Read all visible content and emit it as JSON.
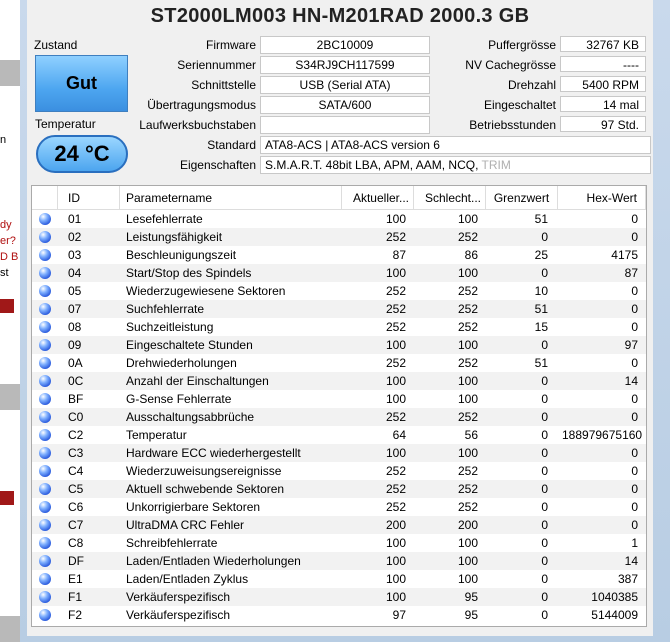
{
  "title": "ST2000LM003 HN-M201RAD  2000.3 GB",
  "status": {
    "health_label": "Zustand",
    "health_value": "Gut",
    "temp_label": "Temperatur",
    "temp_value": "24 °C"
  },
  "info": {
    "firmware_label": "Firmware",
    "firmware": "2BC10009",
    "serial_label": "Seriennummer",
    "serial": "S34RJ9CH117599",
    "interface_label": "Schnittstelle",
    "interface": "USB (Serial ATA)",
    "transfer_label": "Übertragungsmodus",
    "transfer": "SATA/600",
    "drive_letter_label": "Laufwerksbuchstaben",
    "drive_letter": "",
    "standard_label": "Standard",
    "standard": "ATA8-ACS | ATA8-ACS version 6",
    "features_label": "Eigenschaften",
    "features": "S.M.A.R.T.  48bit LBA,  APM,  AAM,  NCQ,",
    "features_disabled": "TRIM",
    "buffer_label": "Puffergrösse",
    "buffer": "32767 KB",
    "nvcache_label": "NV Cachegrösse",
    "nvcache": "----",
    "rpm_label": "Drehzahl",
    "rpm": "5400 RPM",
    "powercount_label": "Eingeschaltet",
    "powercount": "14 mal",
    "hours_label": "Betriebsstunden",
    "hours": "97 Std."
  },
  "table": {
    "headers": [
      "ID",
      "Parametername",
      "Aktueller...",
      "Schlecht...",
      "Grenzwert",
      "Hex-Wert"
    ],
    "rows": [
      [
        "01",
        "Lesefehlerrate",
        "100",
        "100",
        "51",
        "0"
      ],
      [
        "02",
        "Leistungsfähigkeit",
        "252",
        "252",
        "0",
        "0"
      ],
      [
        "03",
        "Beschleunigungszeit",
        "87",
        "86",
        "25",
        "4175"
      ],
      [
        "04",
        "Start/Stop des Spindels",
        "100",
        "100",
        "0",
        "87"
      ],
      [
        "05",
        "Wiederzugewiesene Sektoren",
        "252",
        "252",
        "10",
        "0"
      ],
      [
        "07",
        "Suchfehlerrate",
        "252",
        "252",
        "51",
        "0"
      ],
      [
        "08",
        "Suchzeitleistung",
        "252",
        "252",
        "15",
        "0"
      ],
      [
        "09",
        "Eingeschaltete Stunden",
        "100",
        "100",
        "0",
        "97"
      ],
      [
        "0A",
        "Drehwiederholungen",
        "252",
        "252",
        "51",
        "0"
      ],
      [
        "0C",
        "Anzahl der Einschaltungen",
        "100",
        "100",
        "0",
        "14"
      ],
      [
        "BF",
        "G-Sense Fehlerrate",
        "100",
        "100",
        "0",
        "0"
      ],
      [
        "C0",
        "Ausschaltungsabbrüche",
        "252",
        "252",
        "0",
        "0"
      ],
      [
        "C2",
        "Temperatur",
        "64",
        "56",
        "0",
        "188979675160"
      ],
      [
        "C3",
        "Hardware ECC wiederhergestellt",
        "100",
        "100",
        "0",
        "0"
      ],
      [
        "C4",
        "Wiederzuweisungsereignisse",
        "252",
        "252",
        "0",
        "0"
      ],
      [
        "C5",
        "Aktuell schwebende Sektoren",
        "252",
        "252",
        "0",
        "0"
      ],
      [
        "C6",
        "Unkorrigierbare Sektoren",
        "252",
        "252",
        "0",
        "0"
      ],
      [
        "C7",
        "UltraDMA CRC Fehler",
        "200",
        "200",
        "0",
        "0"
      ],
      [
        "C8",
        "Schreibfehlerrate",
        "100",
        "100",
        "0",
        "1"
      ],
      [
        "DF",
        "Laden/Entladen Wiederholungen",
        "100",
        "100",
        "0",
        "14"
      ],
      [
        "E1",
        "Laden/Entladen Zyklus",
        "100",
        "100",
        "0",
        "387"
      ],
      [
        "F1",
        "Verkäuferspezifisch",
        "100",
        "95",
        "0",
        "1040385"
      ],
      [
        "F2",
        "Verkäuferspezifisch",
        "97",
        "95",
        "0",
        "5144009"
      ]
    ]
  },
  "background": {
    "snippets": [
      "n",
      "dy",
      "er?",
      "D B",
      "st"
    ],
    "colors": {
      "status_good": "#4da6f0",
      "status_dot": "#1f4fd8",
      "accent_red": "#a01818"
    }
  }
}
